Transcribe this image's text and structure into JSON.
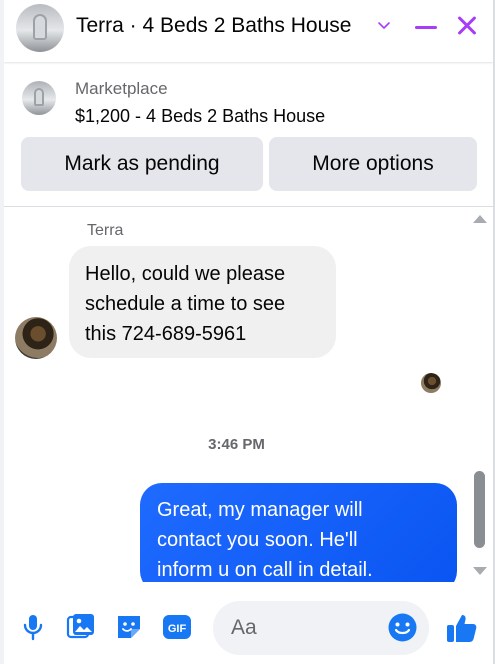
{
  "header": {
    "title": "Terra · 4 Beds 2 Baths House"
  },
  "marketplace": {
    "label": "Marketplace",
    "listing": "$1,200 - 4 Beds 2 Baths House",
    "mark_pending_label": "Mark as pending",
    "more_options_label": "More options"
  },
  "conversation": {
    "sender_name": "Terra",
    "incoming_lines": [
      "Hello,  could we please",
      "schedule a time to see",
      "this 724-689-5961"
    ],
    "timestamp": "3:46 PM",
    "outgoing_lines": [
      "Great, my manager will",
      "contact you soon. He'll",
      "inform u on call in detail."
    ]
  },
  "composer": {
    "placeholder": "Aa",
    "gif_label": "GIF"
  },
  "colors": {
    "accent": "#a73df8",
    "composer_icon": "#1877f2",
    "outgoing_bubble": "#0a55f2",
    "incoming_bubble": "#f0f0f0"
  },
  "icons": [
    "chevron-down-icon",
    "minimize-icon",
    "close-icon",
    "microphone-icon",
    "photo-icon",
    "sticker-icon",
    "gif-icon",
    "emoji-icon",
    "thumbs-up-icon"
  ]
}
